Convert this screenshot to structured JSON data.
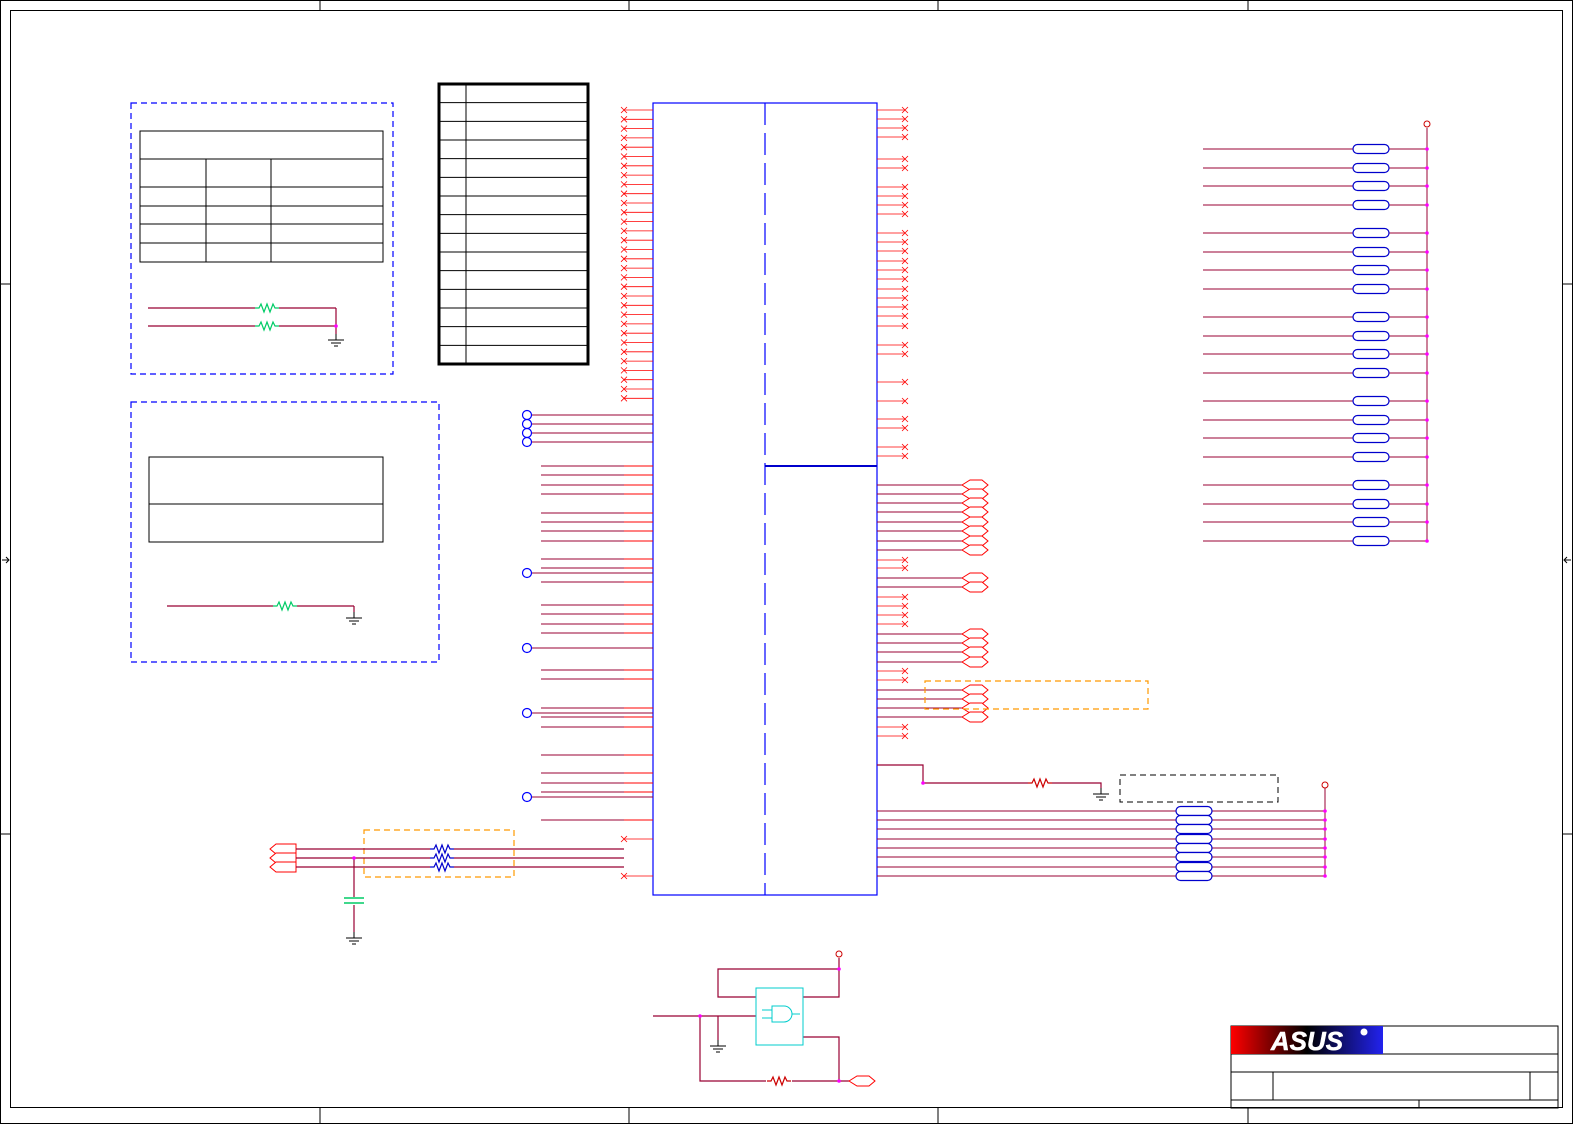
{
  "title_block": {
    "logo": {
      "text": "ASUS",
      "gradient": [
        "#ff0000",
        "#000000",
        "#2222ee"
      ],
      "letter_colors": [
        "#ff0000",
        "#ff8800",
        "#22bb22",
        "#ffcc00",
        "#2222ee"
      ]
    },
    "fields": [
      "",
      "",
      "",
      "",
      ""
    ]
  },
  "config_table": {
    "title": "",
    "headers": [
      "",
      "",
      ""
    ],
    "rows": [
      [
        "",
        "",
        ""
      ],
      [
        "",
        "",
        ""
      ],
      [
        "",
        "",
        ""
      ],
      [
        "",
        "",
        ""
      ]
    ]
  },
  "note_box": {
    "lines": [
      "",
      ""
    ]
  },
  "strap_table": {
    "rows": [
      "",
      "",
      "",
      "",
      "",
      "",
      "",
      "",
      "",
      "",
      "",
      "",
      "",
      "",
      ""
    ]
  }
}
